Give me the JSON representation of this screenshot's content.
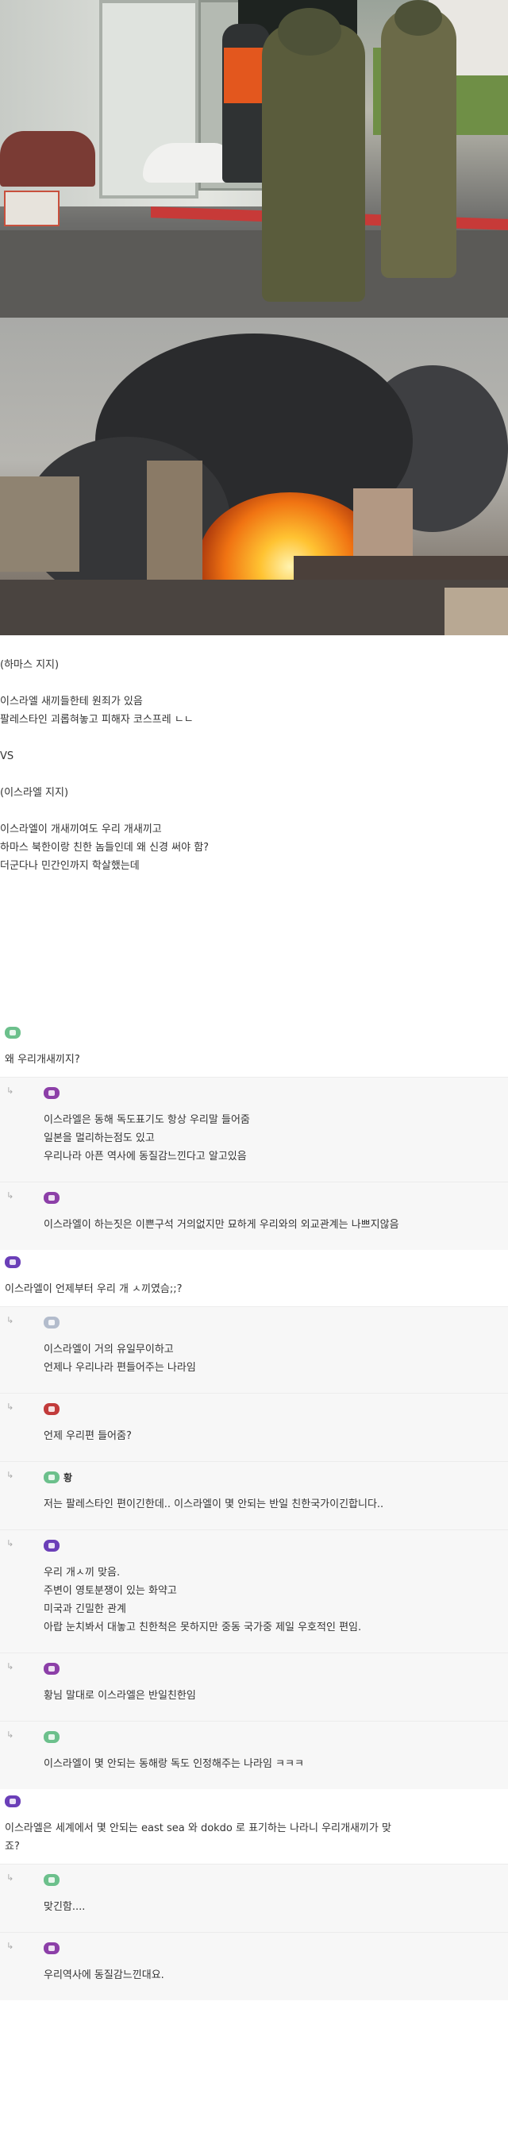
{
  "post": {
    "lines": [
      "(하마스 지지)",
      "",
      "이스라엘 새끼들한테 원죄가 있음",
      "팔레스타인 괴롭혀놓고 피해자 코스프레 ㄴㄴ",
      "",
      "VS",
      "",
      "(이스라엘 지지)",
      "",
      "이스라엘이 개새끼여도 우리 개새끼고",
      "하마스 북한이랑 친한 놈들인데 왜 신경 써야 함?",
      "더군다나 민간인까지 학살했는데"
    ]
  },
  "comments": [
    {
      "type": "top",
      "badge_color": "#6cc08c",
      "nick": "",
      "lines": [
        "왜 우리개새끼지?"
      ]
    },
    {
      "type": "reply",
      "badge_color": "#8c3fa8",
      "nick": "",
      "lines": [
        "이스라엘은 동해 독도표기도 항상 우리말 들어줌",
        "일본을 멀리하는점도 있고",
        "우리나라 아픈 역사에 동질감느낀다고 알고있음"
      ]
    },
    {
      "type": "reply",
      "badge_color": "#8c3fa8",
      "nick": "",
      "lines": [
        "이스라엘이 하는짓은 이쁜구석 거의없지만 묘하게 우리와의 외교관계는 나쁘지않음"
      ]
    },
    {
      "type": "top",
      "badge_color": "#6b3fb8",
      "nick": "",
      "lines": [
        "이스라엘이 언제부터 우리 개 ㅅ끼였슴;;?"
      ]
    },
    {
      "type": "reply",
      "badge_color": "#b3bccc",
      "nick": "",
      "lines": [
        "이스라엘이 거의 유일무이하고",
        "언제나 우리나라 편들어주는 나라임"
      ]
    },
    {
      "type": "reply",
      "badge_color": "#c23b3b",
      "nick": "",
      "lines": [
        "언제 우리편 들어줌?"
      ]
    },
    {
      "type": "reply",
      "badge_color": "#6cc08c",
      "nick": "황",
      "lines": [
        "저는 팔레스타인 편이긴한데.. 이스라엘이 몇 안되는 반일 친한국가이긴합니다.."
      ]
    },
    {
      "type": "reply",
      "badge_color": "#6b3fb8",
      "nick": "",
      "lines": [
        "우리 개ㅅ끼 맞음.",
        "주변이 영토분쟁이 있는 화약고",
        "미국과 긴밀한 관계",
        "아랍 눈치봐서 대놓고 친한척은 못하지만 중동 국가중 제일 우호적인 편임."
      ]
    },
    {
      "type": "reply",
      "badge_color": "#8c3fa8",
      "nick": "",
      "lines": [
        "황님 말대로 이스라엘은 반일친한임"
      ]
    },
    {
      "type": "reply",
      "badge_color": "#6cc08c",
      "nick": "",
      "lines": [
        "이스라엘이 몇 안되는 동해랑 독도 인정해주는 나라임 ㅋㅋㅋ"
      ]
    },
    {
      "type": "top",
      "badge_color": "#6b3fb8",
      "nick": "",
      "lines": [
        "이스라엘은 세계에서 몇 안되는 east sea 와 dokdo 로 표기하는 나라니 우리개새끼가 맞",
        "죠?"
      ]
    },
    {
      "type": "reply",
      "badge_color": "#6cc08c",
      "nick": "",
      "lines": [
        "맞긴함...."
      ]
    },
    {
      "type": "reply",
      "badge_color": "#8c3fa8",
      "nick": "",
      "lines": [
        "우리역사에 동질감느낀대요."
      ]
    }
  ],
  "reply_arrow": "↳"
}
